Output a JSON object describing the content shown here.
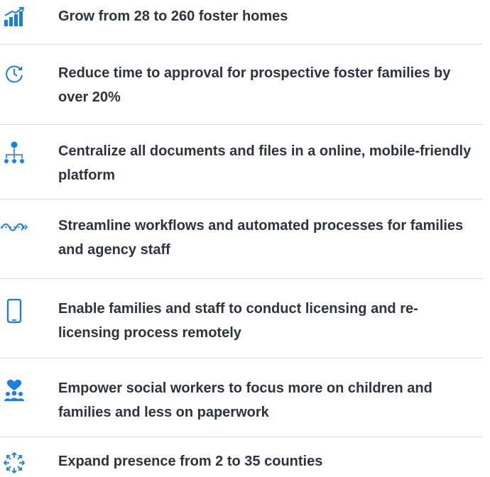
{
  "colors": {
    "accent": "#1a7fe0",
    "text": "#2b3440",
    "divider": "#d9dde2"
  },
  "items": [
    {
      "icon": "bar-chart-icon",
      "text": "Grow from 28 to 260 foster homes"
    },
    {
      "icon": "clock-refresh-icon",
      "text": "Reduce time to approval for prospective foster families by over 20%"
    },
    {
      "icon": "org-chart-icon",
      "text": "Centralize all documents and files in a online, mobile-friendly platform"
    },
    {
      "icon": "workflow-arrows-icon",
      "text": "Streamline workflows and automated processes for families and agency staff"
    },
    {
      "icon": "smartphone-icon",
      "text": "Enable families and staff to conduct licensing and re-licensing process remotely"
    },
    {
      "icon": "heart-people-icon",
      "text": "Empower social workers to focus more on children and families and less on paperwork"
    },
    {
      "icon": "expand-arrows-icon",
      "text": "Expand presence from 2 to 35 counties"
    }
  ]
}
